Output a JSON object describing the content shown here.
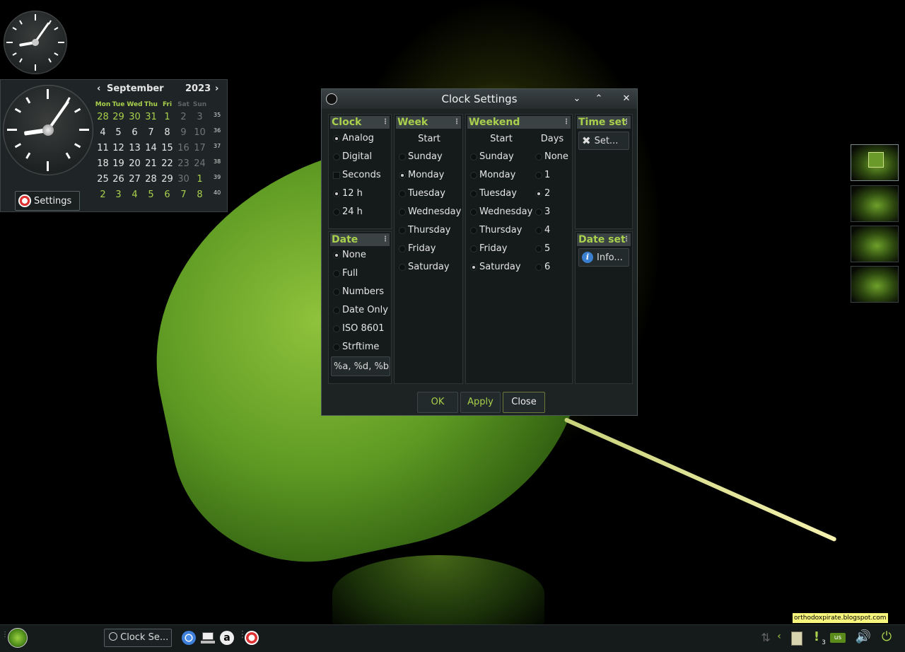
{
  "calendar": {
    "month": "September",
    "year": "2023",
    "prev_glyph": "‹",
    "next_glyph": "›",
    "day_names": [
      "Mon",
      "Tue",
      "Wed",
      "Thu",
      "Fri",
      "Sat",
      "Sun"
    ],
    "weeks": [
      {
        "num": "35",
        "days": [
          "28",
          "29",
          "30",
          "31",
          "1",
          "2",
          "3"
        ]
      },
      {
        "num": "36",
        "days": [
          "4",
          "5",
          "6",
          "7",
          "8",
          "9",
          "10"
        ]
      },
      {
        "num": "37",
        "days": [
          "11",
          "12",
          "13",
          "14",
          "15",
          "16",
          "17"
        ]
      },
      {
        "num": "38",
        "days": [
          "18",
          "19",
          "20",
          "21",
          "22",
          "23",
          "24"
        ]
      },
      {
        "num": "39",
        "days": [
          "25",
          "26",
          "27",
          "28",
          "29",
          "30",
          "1"
        ]
      },
      {
        "num": "40",
        "days": [
          "2",
          "3",
          "4",
          "5",
          "6",
          "7",
          "8"
        ]
      }
    ],
    "settings_label": "Settings"
  },
  "dialog": {
    "title": "Clock Settings",
    "buttons": {
      "minimize": "⌄",
      "maximize": "⌃",
      "close": "✕"
    },
    "clock_group": {
      "title": "Clock",
      "options": [
        "Analog",
        "Digital",
        "Seconds",
        "12 h",
        "24 h"
      ],
      "selected": [
        "Analog",
        "12 h"
      ]
    },
    "date_group": {
      "title": "Date",
      "options": [
        "None",
        "Full",
        "Numbers",
        "Date Only",
        "ISO 8601",
        "Strftime"
      ],
      "selected": "None",
      "format_value": "%a, %d, %b"
    },
    "week_group": {
      "title": "Week",
      "start_label": "Start",
      "options": [
        "Sunday",
        "Monday",
        "Tuesday",
        "Wednesday",
        "Thursday",
        "Friday",
        "Saturday"
      ],
      "selected": "Monday"
    },
    "weekend_group": {
      "title": "Weekend",
      "start_label": "Start",
      "days_label": "Days",
      "start_options": [
        "Sunday",
        "Monday",
        "Tuesday",
        "Wednesday",
        "Thursday",
        "Friday",
        "Saturday"
      ],
      "start_selected": "Saturday",
      "days_options": [
        "None",
        "1",
        "2",
        "3",
        "4",
        "5",
        "6"
      ],
      "days_selected": "2"
    },
    "time_set_group": {
      "title": "Time set",
      "button_label": "Set..."
    },
    "date_set_group": {
      "title": "Date set",
      "button_label": "Info..."
    },
    "footer": {
      "ok": "OK",
      "apply": "Apply",
      "close": "Close"
    }
  },
  "taskbar": {
    "task_clock_label": "Clock Se...",
    "keyboard_layout": "us",
    "notification_count": "3",
    "watermark": "orthodoxpirate.blogspot.com"
  },
  "colors": {
    "accent": "#a8d04c",
    "panel": "#1d2222",
    "header": "#3a4244"
  }
}
